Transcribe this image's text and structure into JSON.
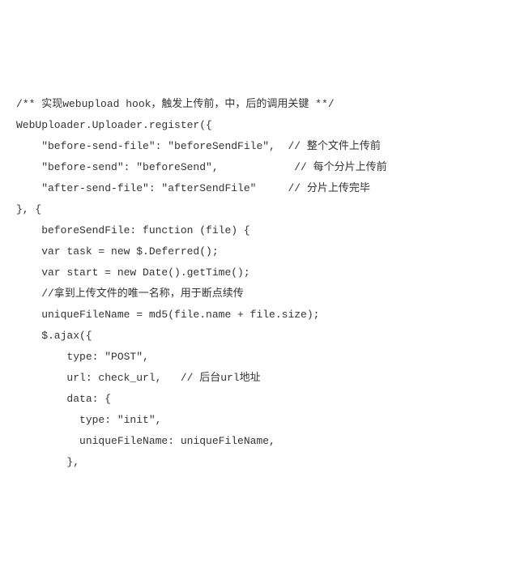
{
  "code": {
    "lines": [
      "/** 实现webupload hook，触发上传前，中，后的调用关键 **/",
      "WebUploader.Uploader.register({",
      "    \"before-send-file\": \"beforeSendFile\",  // 整个文件上传前",
      "    \"before-send\": \"beforeSend\",            // 每个分片上传前",
      "    \"after-send-file\": \"afterSendFile\"     // 分片上传完毕",
      "}, {",
      "    beforeSendFile: function (file) {",
      "    var task = new $.Deferred();",
      "    var start = new Date().getTime();",
      "",
      "    //拿到上传文件的唯一名称，用于断点续传",
      "    uniqueFileName = md5(file.name + file.size);",
      "",
      "    $.ajax({",
      "        type: \"POST\",",
      "        url: check_url,   // 后台url地址",
      "        data: {",
      "          type: \"init\",",
      "          uniqueFileName: uniqueFileName,",
      "        },"
    ]
  }
}
